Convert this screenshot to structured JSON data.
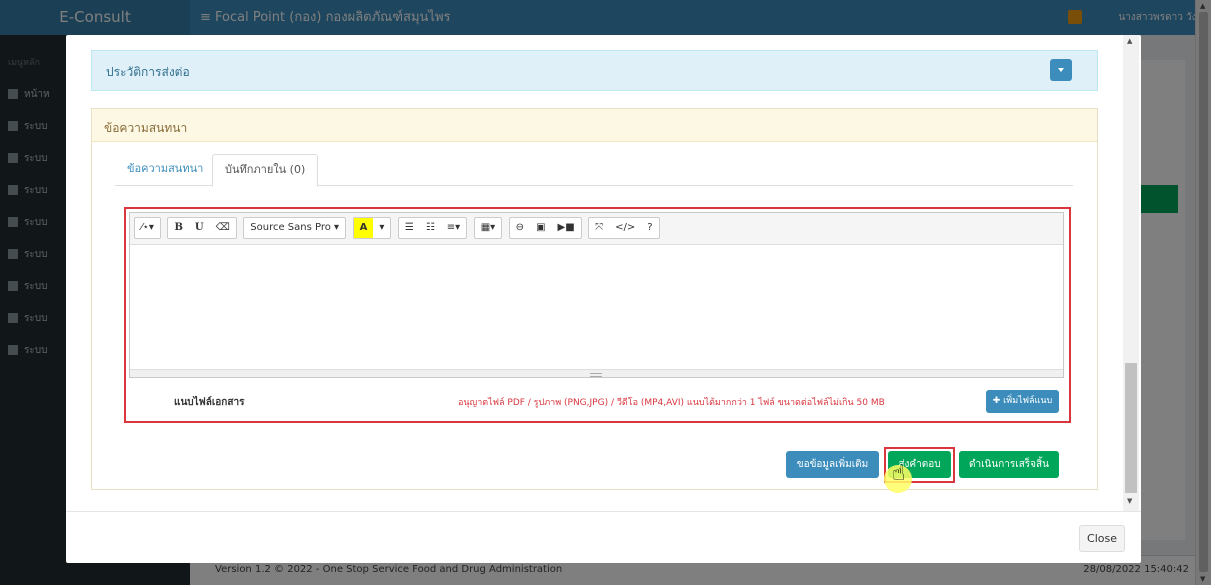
{
  "app": {
    "brand": "E-Consult",
    "header_title": "≡  Focal Point (กอง) กองผลิตภัณฑ์สมุนไพร",
    "user": "นางสาวพรดาว วังดี",
    "sidebar_heading": "เมนูหลัก",
    "sidebar_items": [
      "หน้าห",
      "ระบบ",
      "ระบบ",
      "ระบบ",
      "ระบบ",
      "ระบบ",
      "ระบบ",
      "ระบบ",
      "ระบบ"
    ],
    "footer_left": "Version 1.2 © 2022 - One Stop Service Food and Drug Administration",
    "footer_right": "28/08/2022 15:40:42"
  },
  "modal": {
    "history_title": "ประวัติการส่งต่อ",
    "conversation_title": "ข้อความสนทนา",
    "tabs": [
      {
        "label": "ข้อความสนทนา",
        "active": false
      },
      {
        "label": "บันทึกภายใน (0)",
        "active": true
      }
    ],
    "toolbar": {
      "magic": "⁄⋆▾",
      "bold": "B",
      "underline": "U",
      "eraser": "⌫",
      "font": "Source Sans Pro ▾",
      "highlight": "A",
      "caret": "▾",
      "ul": "☰",
      "ol": "☷",
      "align": "≡▾",
      "table": "▦▾",
      "link": "⊖",
      "image": "▣",
      "video": "▶■",
      "fullscreen": "⤧",
      "code": "</>",
      "help": "?"
    },
    "attach_label": "แนบไฟล์เอกสาร",
    "attach_note": "อนุญาตไฟล์ PDF / รูปภาพ (PNG,JPG) / วีดีโอ (MP4,AVI) แนบได้มากกว่า 1 ไฟล์ ขนาดต่อไฟล์ไม่เกิน 50 MB",
    "attach_button": "✚ เพิ่มไฟล์แนบ",
    "buttons": {
      "more_info": "ขอข้อมูลเพิ่มเติม",
      "send_reply": "ส่งคำตอบ",
      "finish": "ดำเนินการเสร็จสิ้น"
    },
    "close": "Close"
  },
  "colors": {
    "primary": "#3c8dbc",
    "success": "#00a65a",
    "highlight_border": "#d9363e"
  }
}
